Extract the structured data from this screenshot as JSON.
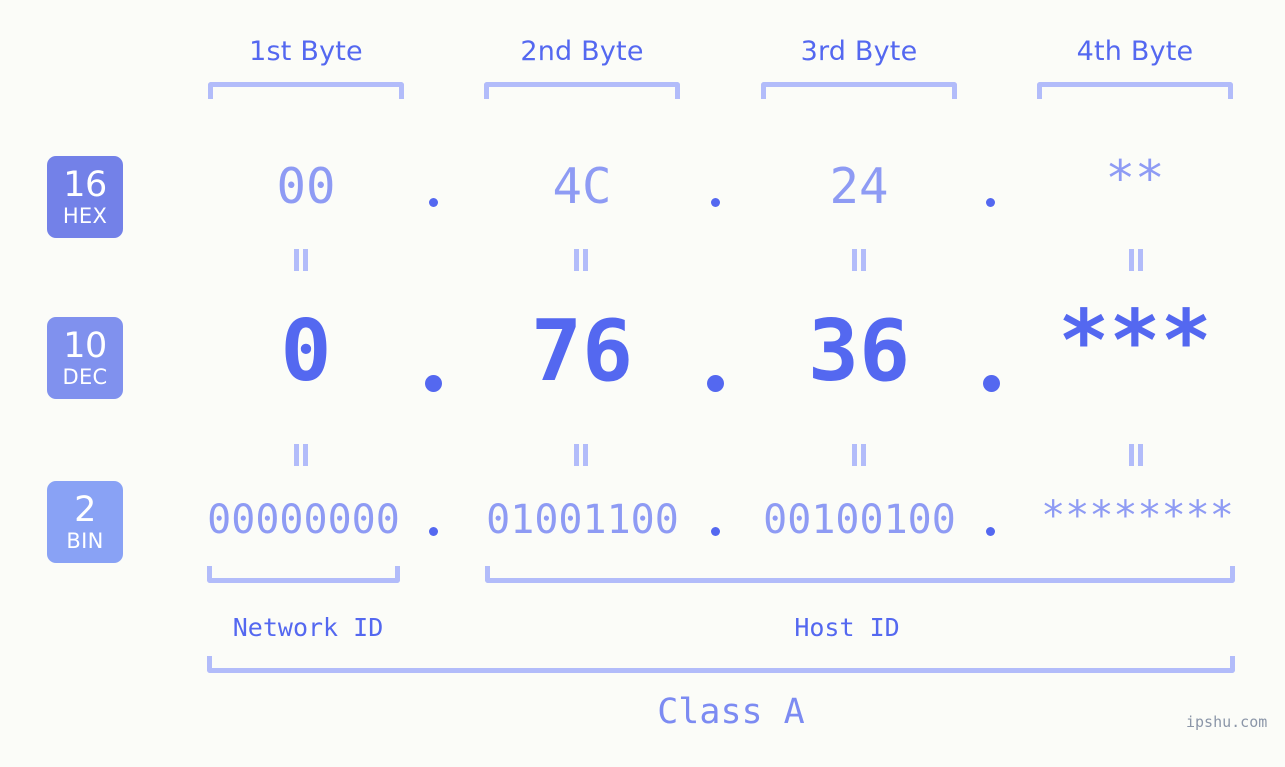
{
  "background_color": "#fbfcf8",
  "accent_strong": "#5468f0",
  "accent_light": "#8e9bf4",
  "accent_bracket": "#b2bcfa",
  "byte_headers": [
    {
      "label": "1st Byte"
    },
    {
      "label": "2nd Byte"
    },
    {
      "label": "3rd Byte"
    },
    {
      "label": "4th Byte"
    }
  ],
  "rows": [
    {
      "badge_number": "16",
      "badge_abbr": "HEX",
      "badge_color": "#7381e8",
      "values": [
        "00",
        "4C",
        "24",
        "**"
      ],
      "separator": "."
    },
    {
      "badge_number": "10",
      "badge_abbr": "DEC",
      "badge_color": "#8091ee",
      "values": [
        "0",
        "76",
        "36",
        "***"
      ],
      "separator": "."
    },
    {
      "badge_number": "2",
      "badge_abbr": "BIN",
      "badge_color": "#89a2f5",
      "values": [
        "00000000",
        "01001100",
        "00100100",
        "********"
      ],
      "separator": "."
    }
  ],
  "equals_marks": {
    "glyph": "=",
    "rotated": true,
    "count_per_gap": 4,
    "gaps": 2
  },
  "segments": {
    "network_id_label": "Network ID",
    "host_id_label": "Host ID"
  },
  "class_label": "Class A",
  "watermark": "ipshu.com"
}
